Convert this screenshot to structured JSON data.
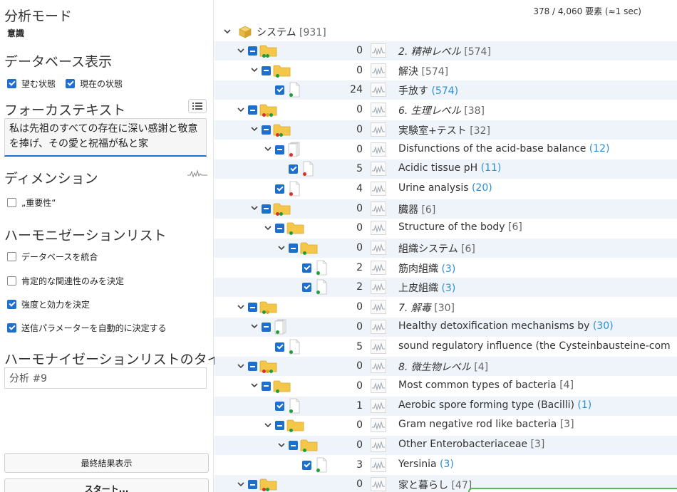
{
  "left": {
    "analysis_mode_title": "分析モード",
    "analysis_mode_value": "意識",
    "db_display_title": "データベース表示",
    "db_checks": [
      {
        "label": "望む状態",
        "checked": true
      },
      {
        "label": "現在の状態",
        "checked": true
      }
    ],
    "focus_title": "フォーカステキスト",
    "focus_text": "私は先祖のすべての存在に深い感謝と敬意を捧げ、その愛と祝福が私と家",
    "dimension_title": "ディメンション",
    "dimension_check": {
      "label": "„重要性“",
      "checked": false
    },
    "harmonize_title": "ハーモニゼーションリスト",
    "harmonize_checks": [
      {
        "label": "データベースを統合",
        "checked": false
      },
      {
        "label": "肯定的な関連性のみを決定",
        "checked": false
      },
      {
        "label": "強度と効力を決定",
        "checked": true
      },
      {
        "label": "送信パラメーターを自動的に決定する",
        "checked": true
      }
    ],
    "list_title_heading": "ハーモナイゼーションリストのタイトル",
    "list_title_value": "分析 #9",
    "final_button": "最終結果表示",
    "start_button": "スタート..."
  },
  "right": {
    "status": "378 / 4,060 要素 (≈1 sec)",
    "root": {
      "label": "システム",
      "count": "[931]"
    },
    "rows": [
      {
        "level": 1,
        "type": "folder",
        "dots": [
          "#1e9e3a",
          "#1e9e3a"
        ],
        "num": "0",
        "text": "2. 精神レベル",
        "italic": true,
        "badge": "[574]",
        "badgeBlue": false
      },
      {
        "level": 2,
        "type": "folder",
        "dots": [
          "#1e9e3a"
        ],
        "num": "0",
        "text": "解決",
        "italic": false,
        "badge": "[574]",
        "badgeBlue": false
      },
      {
        "level": 3,
        "type": "doc",
        "dots": [
          "#1e9e3a"
        ],
        "num": "24",
        "text": "手放す",
        "italic": false,
        "badge": "(574)",
        "badgeBlue": true
      },
      {
        "level": 1,
        "type": "folder",
        "dots": [
          "#d9302c",
          "#e2a51c",
          "#1e9e3a"
        ],
        "num": "0",
        "text": "6. 生理レベル",
        "italic": true,
        "badge": "[38]",
        "badgeBlue": false
      },
      {
        "level": 2,
        "type": "folder",
        "dots": [
          "#d9302c",
          "#1e9e3a"
        ],
        "num": "0",
        "text": "実験室+テスト",
        "italic": false,
        "badge": "[32]",
        "badgeBlue": false
      },
      {
        "level": 3,
        "type": "docstack",
        "dots": [
          "#d9302c"
        ],
        "num": "0",
        "text": "Disfunctions of the acid-base balance",
        "italic": false,
        "badge": "(12)",
        "badgeBlue": true
      },
      {
        "level": 4,
        "type": "doc",
        "dots": [
          "#d9302c"
        ],
        "num": "5",
        "text": "Acidic tissue pH",
        "italic": false,
        "badge": "(11)",
        "badgeBlue": true
      },
      {
        "level": 3,
        "type": "doc",
        "dots": [
          "#d9302c"
        ],
        "num": "4",
        "text": "Urine analysis",
        "italic": false,
        "badge": "(20)",
        "badgeBlue": true
      },
      {
        "level": 2,
        "type": "folder",
        "dots": [
          "#d9302c",
          "#1e9e3a"
        ],
        "num": "0",
        "text": "臓器",
        "italic": false,
        "badge": "[6]",
        "badgeBlue": false
      },
      {
        "level": 3,
        "type": "folder",
        "dots": [
          "#1e9e3a"
        ],
        "num": "0",
        "text": "Structure of the body",
        "italic": false,
        "badge": "[6]",
        "badgeBlue": false
      },
      {
        "level": 4,
        "type": "folder",
        "dots": [
          "#1e9e3a"
        ],
        "num": "0",
        "text": "組織システム",
        "italic": false,
        "badge": "[6]",
        "badgeBlue": false
      },
      {
        "level": 5,
        "type": "doc",
        "dots": [
          "#1e9e3a"
        ],
        "num": "2",
        "text": "筋肉組織",
        "italic": false,
        "badge": "(3)",
        "badgeBlue": true
      },
      {
        "level": 5,
        "type": "doc",
        "dots": [
          "#1e9e3a"
        ],
        "num": "2",
        "text": "上皮組織",
        "italic": false,
        "badge": "(3)",
        "badgeBlue": true
      },
      {
        "level": 1,
        "type": "folder",
        "dots": [
          "#1e9e3a",
          "#e2a51c"
        ],
        "num": "0",
        "text": "7. 解毒",
        "italic": true,
        "badge": "[30]",
        "badgeBlue": false
      },
      {
        "level": 2,
        "type": "docstack",
        "dots": [
          "#1e9e3a"
        ],
        "num": "0",
        "text": "Healthy detoxification mechanisms by",
        "italic": false,
        "badge": "(30)",
        "badgeBlue": true
      },
      {
        "level": 3,
        "type": "doc",
        "dots": [
          "#1e9e3a"
        ],
        "num": "5",
        "text": "sound regulatory influence (the Cysteinbausteine-com",
        "italic": false,
        "badge": "",
        "badgeBlue": false
      },
      {
        "level": 1,
        "type": "folder",
        "dots": [
          "#d9302c",
          "#e2a51c",
          "#1e9e3a"
        ],
        "num": "0",
        "text": "8. 微生物レベル",
        "italic": true,
        "badge": "[4]",
        "badgeBlue": false
      },
      {
        "level": 2,
        "type": "folder",
        "dots": [
          "#1e9e3a"
        ],
        "num": "0",
        "text": "Most common types of bacteria",
        "italic": false,
        "badge": "[4]",
        "badgeBlue": false
      },
      {
        "level": 3,
        "type": "doc",
        "dots": [
          "#1e9e3a"
        ],
        "num": "1",
        "text": "Aerobic spore forming type (Bacilli)",
        "italic": false,
        "badge": "(1)",
        "badgeBlue": true
      },
      {
        "level": 3,
        "type": "folder",
        "dots": [
          "#1e9e3a"
        ],
        "num": "0",
        "text": "Gram negative rod like bacteria",
        "italic": false,
        "badge": "[3]",
        "badgeBlue": false
      },
      {
        "level": 4,
        "type": "folder",
        "dots": [
          "#1e9e3a"
        ],
        "num": "0",
        "text": "Other Enterobacteriaceae",
        "italic": false,
        "badge": "[3]",
        "badgeBlue": false
      },
      {
        "level": 5,
        "type": "doc",
        "dots": [
          "#1e9e3a"
        ],
        "num": "3",
        "text": "Yersinia",
        "italic": false,
        "badge": "(3)",
        "badgeBlue": true
      },
      {
        "level": 1,
        "type": "folder",
        "dots": [
          "#d9302c",
          "#1e9e3a"
        ],
        "num": "0",
        "text": "家と暮らし",
        "italic": false,
        "badge": "[47]",
        "badgeBlue": false
      }
    ]
  }
}
